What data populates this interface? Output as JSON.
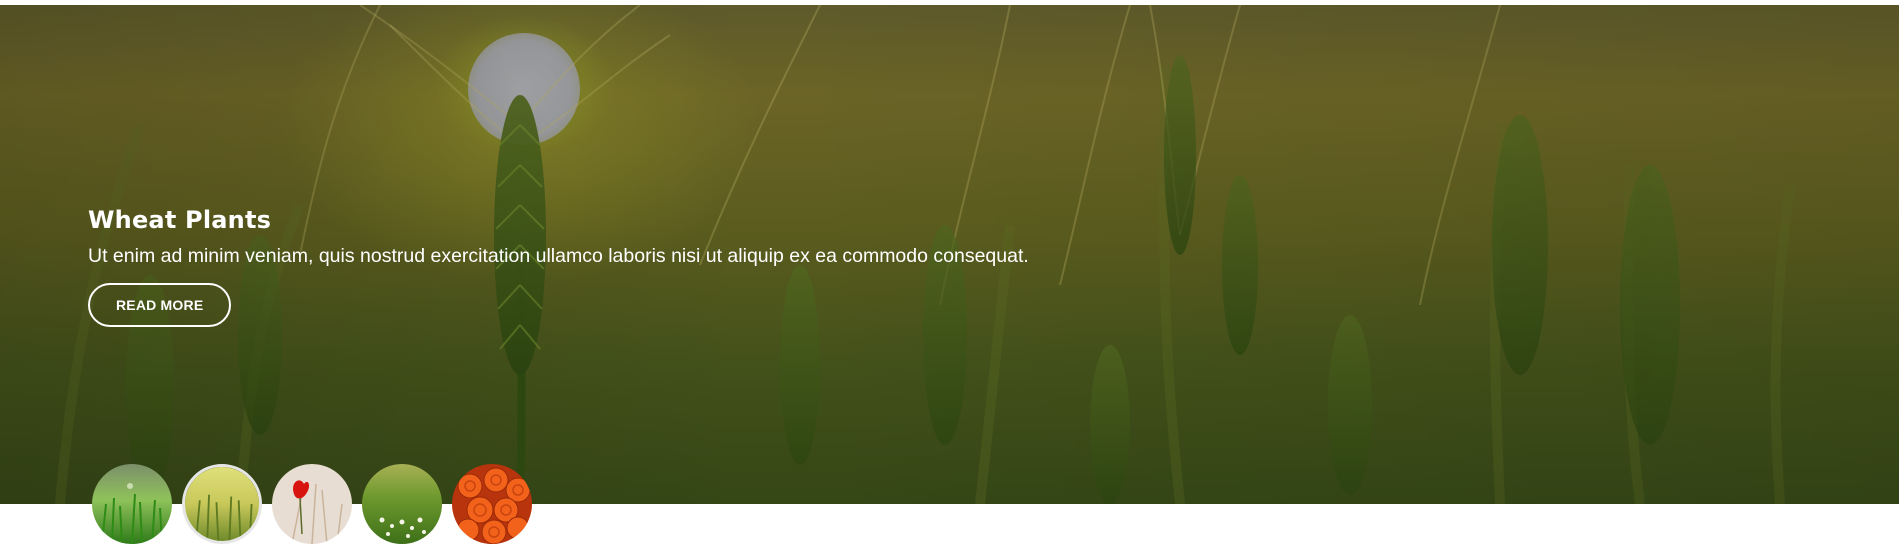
{
  "slider": {
    "title": "Wheat Plants",
    "description": "Ut enim ad minim veniam, quis nostrud exercitation ullamco laboris nisi ut aliquip ex ea commodo consequat.",
    "button_label": "READ MORE",
    "active_index": 1,
    "colors": {
      "overlay": "#4b5520",
      "button_border": "#ffffff",
      "text": "#ffffff"
    }
  },
  "thumbnails": [
    {
      "name": "green grass with dew",
      "icon": "grass-thumbnail"
    },
    {
      "name": "yellow-green wheat",
      "icon": "wheat-thumbnail"
    },
    {
      "name": "red poppy",
      "icon": "poppy-thumbnail"
    },
    {
      "name": "meadow with white flowers",
      "icon": "meadow-thumbnail"
    },
    {
      "name": "orange roses",
      "icon": "roses-thumbnail"
    }
  ]
}
